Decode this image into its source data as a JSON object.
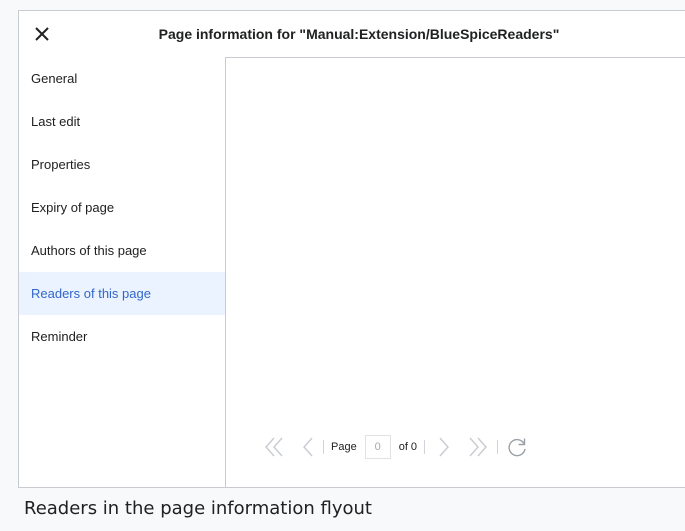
{
  "dialog": {
    "title": "Page information for \"Manual:Extension/BlueSpiceReaders\"",
    "close_icon": "close-icon"
  },
  "sidebar": {
    "items": [
      {
        "label": "General",
        "active": false
      },
      {
        "label": "Last edit",
        "active": false
      },
      {
        "label": "Properties",
        "active": false
      },
      {
        "label": "Expiry of page",
        "active": false
      },
      {
        "label": "Authors of this page",
        "active": false
      },
      {
        "label": "Readers of this page",
        "active": true
      },
      {
        "label": "Reminder",
        "active": false
      }
    ]
  },
  "pager": {
    "page_label": "Page",
    "page_value": "0",
    "of_label": "of 0",
    "icons": [
      "first-page-icon",
      "previous-page-icon",
      "next-page-icon",
      "last-page-icon",
      "refresh-icon"
    ]
  },
  "caption": "Readers in the page information flyout",
  "colors": {
    "accent": "#3366cc",
    "active_background": "#eaf3ff",
    "border": "#c8ccd1",
    "disabled_icon": "#c8ccd1"
  }
}
